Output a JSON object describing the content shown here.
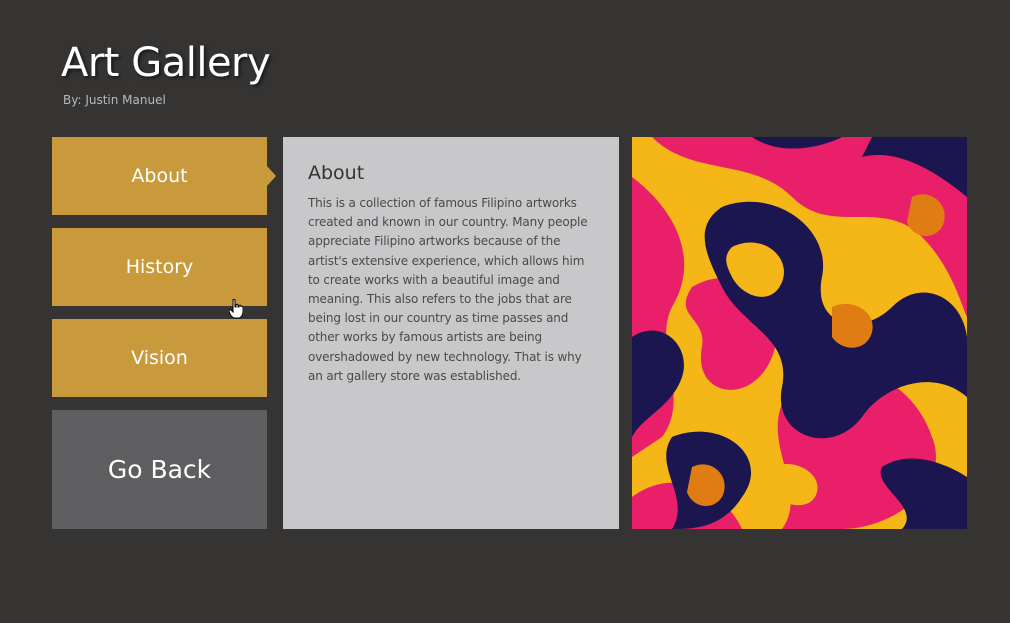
{
  "header": {
    "title": "Art Gallery",
    "byline": "By: Justin Manuel"
  },
  "nav": {
    "items": [
      {
        "label": "About",
        "active": true
      },
      {
        "label": "History",
        "active": false
      },
      {
        "label": "Vision",
        "active": false
      }
    ],
    "back_label": "Go Back"
  },
  "content": {
    "heading": "About",
    "body": "This is a collection of famous Filipino artworks created and known in our country. Many people appreciate Filipino artworks because of the artist's extensive experience, which allows him to create works with a beautiful image and meaning. This also refers to the jobs that are being lost in our country as time passes and other works by famous artists are being overshadowed by new technology. That is why an art gallery store was established."
  },
  "colors": {
    "background": "#353433",
    "nav_button": "#c89a3c",
    "back_button": "#5e5d5f",
    "content_panel": "#c8c8ca",
    "art_yellow": "#f5b618",
    "art_pink": "#ea1f6a",
    "art_navy": "#1b1650",
    "art_orange": "#e07d12"
  },
  "icons": {
    "cursor": "hand-pointer-icon"
  }
}
